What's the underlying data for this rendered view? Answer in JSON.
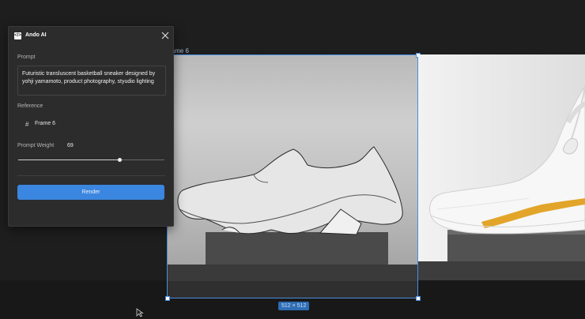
{
  "plugin": {
    "title": "Ando AI",
    "icon": "code-brackets-icon",
    "prompt_label": "Prompt",
    "prompt_value": "Futuristic transluscent basketball sneaker designed by yohji yamamoto, product photography, styudio lighting",
    "reference_label": "Reference",
    "reference_frame": "Frame 6",
    "weight_label": "Prompt Weight",
    "weight_value": "69",
    "weight_fraction": 0.69,
    "render_label": "Render"
  },
  "canvas": {
    "frame_label": "rame 6",
    "size_badge": "512 × 512"
  },
  "colors": {
    "accent": "#3b86e0",
    "selection": "#4a8ee0",
    "panel_bg": "#2c2c2c",
    "canvas_bg": "#1e1e1e",
    "sneaker_stripe": "#e2a52a"
  }
}
